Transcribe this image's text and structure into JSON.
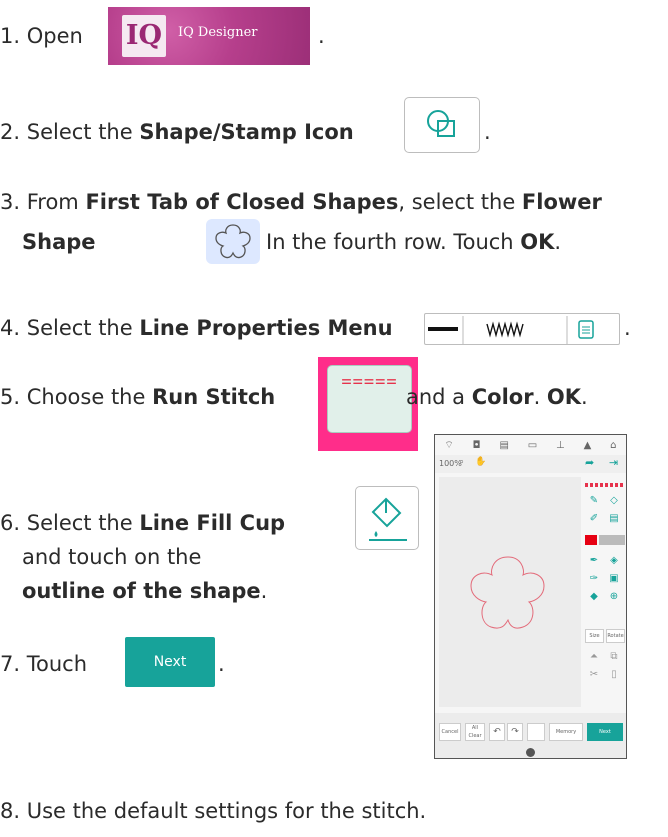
{
  "steps": [
    {
      "num": "1.",
      "parts": [
        "Open"
      ],
      "end": "."
    },
    {
      "num": "2.",
      "text": "Select the ",
      "bold": "Shape/Stamp Icon",
      "end": "."
    },
    {
      "num": "3.",
      "text": "From ",
      "bold1": "First Tab of Closed Shapes",
      "mid": ", select the ",
      "bold2": "Flower",
      "line2_bold": "Shape",
      "line2_text": " In the fourth row. Touch ",
      "line2_bold2": "OK",
      "line2_end": "."
    },
    {
      "num": "4.",
      "text": "Select the ",
      "bold": "Line Properties Menu",
      "end": "."
    },
    {
      "num": "5.",
      "text": "Choose the ",
      "bold": "Run Stitch",
      "mid": "and a ",
      "bold2": "Color",
      "mid2": ". ",
      "bold3": "OK",
      "end": "."
    },
    {
      "num": "6.",
      "text": "Select the  ",
      "bold": "Line Fill Cup",
      "line2": "and touch on the",
      "line3_bold": "outline of the shape",
      "line3_end": "."
    },
    {
      "num": "7.",
      "text": "Touch",
      "end": "."
    },
    {
      "num": "8.",
      "text": "Use the default settings for the stitch."
    }
  ],
  "iq_logo": {
    "mark": "IQ",
    "label": "IQ Designer"
  },
  "run_stitch_pattern": "=====",
  "next_button": "Next",
  "screen": {
    "zoom": "100%",
    "bottom_buttons": [
      "Cancel",
      "All Clear",
      "",
      "",
      "",
      "Memory",
      "Next"
    ],
    "side_buttons": [
      "Size",
      "Rotate"
    ]
  },
  "colors": {
    "iq_pink": "#b63f8c",
    "highlight_pink": "#ff2d8a",
    "teal": "#17a39a",
    "flower_bg": "#dde8ff",
    "outline_red": "#e6334c"
  }
}
